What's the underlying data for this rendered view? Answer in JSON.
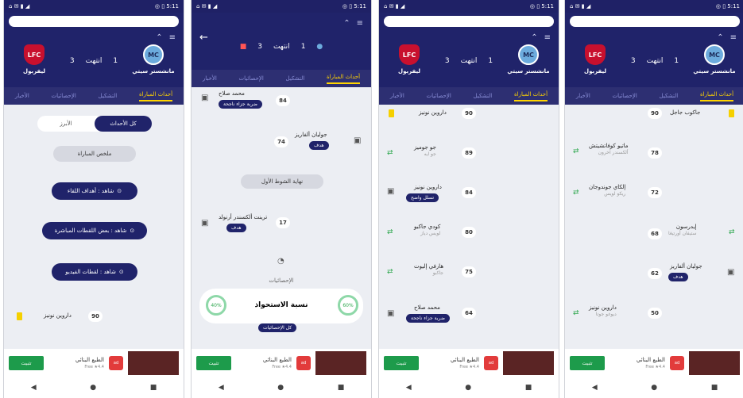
{
  "status": {
    "left": "⌂ ✉ ▮ ◢",
    "right": "◎ ▯ 5:11"
  },
  "match": {
    "home_team": "مانشستر سيتي",
    "away_team": "ليفربول",
    "home_score": "1",
    "away_score": "3",
    "separator": "انتهت"
  },
  "tabs": [
    "أحداث المباراة",
    "التشكيل",
    "الإحصائيات",
    "الأخبار"
  ],
  "screen1": {
    "toggle_all": "كل الأحداث",
    "toggle_key": "الأبرز",
    "match_summary": "ملخص المباراة",
    "btn1": "شاهد : أهداف اللقاء",
    "btn2": "شاهد : بعض اللقطات المباشرة",
    "btn3": "شاهد : لقطات الفيديو",
    "event_name": "داروين نونيز",
    "event_minute": "90"
  },
  "screen2": {
    "ev1_name": "محمد صلاح",
    "ev1_tag": "ضربة جزاء ناجحة",
    "ev1_minute": "84",
    "ev2_name": "جوليان ألفاريز",
    "ev2_tag": "هدف",
    "ev2_minute": "74",
    "halftime": "نهاية الشوط الأول",
    "ev3_name": "ترينت ألكسندر أرنولد",
    "ev3_tag": "هدف",
    "ev3_minute": "17",
    "stats_title": "الإحصائيات",
    "possession_label": "نسبة الاستحواذ",
    "possession_left": "40%",
    "possession_right": "60%",
    "stats_btn": "كل الإحصائيات"
  },
  "screen3": {
    "rows": [
      {
        "name": "داروين نونيز",
        "sub": "",
        "minute": "90"
      },
      {
        "name": "جو جوميز",
        "sub": "جو ايه",
        "minute": "89"
      },
      {
        "name": "داروين نونيز",
        "sub": "",
        "minute": "84"
      },
      {
        "name": "كودي جاكبو",
        "sub": "لويس دياز",
        "minute": "80"
      },
      {
        "name": "هارفي إليوت",
        "sub": "جاكبو",
        "minute": "75"
      },
      {
        "name": "محمد صلاح",
        "sub": "",
        "minute": "64"
      }
    ],
    "tag1": "تسلل واضح",
    "tag2": "ضربة جزاء ناجحة"
  },
  "screen4": {
    "rows": [
      {
        "name": "جاكوب جاجل",
        "minute": "90"
      },
      {
        "name": "ماتيو كوفاتشيتش",
        "sub": "ألكسندر آخرون",
        "minute": "78"
      },
      {
        "name": "إلكاي جوندوجان",
        "sub": "ريكو لويس",
        "minute": "72"
      },
      {
        "name": "إيدرسون",
        "sub": "ستيفان أورتيغا",
        "minute": "68"
      },
      {
        "name": "جوليان ألفاريز",
        "minute": "62"
      },
      {
        "name": "داروين نونيز",
        "sub": "ديوغو جوتا",
        "minute": "50"
      }
    ],
    "tag": "هدف"
  },
  "ad": {
    "button": "تثبيت",
    "text": "الطبع البنائي",
    "sub": "Free ★4.4"
  },
  "nav": [
    "◀",
    "●",
    "■"
  ]
}
